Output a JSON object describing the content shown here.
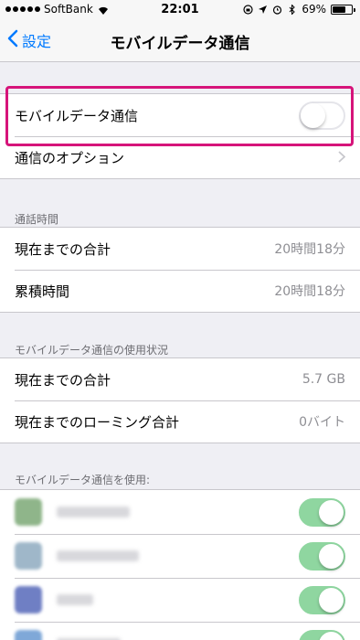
{
  "status_bar": {
    "carrier": "SoftBank",
    "time": "22:01",
    "battery": "69%",
    "battery_level": 0.69
  },
  "nav": {
    "back_label": "設定",
    "title": "モバイルデータ通信"
  },
  "mobile_data": {
    "label": "モバイルデータ通信",
    "enabled": false
  },
  "options": {
    "label": "通信のオプション"
  },
  "call_time": {
    "header": "通話時間",
    "rows": [
      {
        "label": "現在までの合計",
        "value": "20時間18分"
      },
      {
        "label": "累積時間",
        "value": "20時間18分"
      }
    ]
  },
  "usage": {
    "header": "モバイルデータ通信の使用状況",
    "rows": [
      {
        "label": "現在までの合計",
        "value": "5.7 GB"
      },
      {
        "label": "現在までのローミング合計",
        "value": "0バイト"
      }
    ]
  },
  "apps_section": {
    "header": "モバイルデータ通信を使用:",
    "apps": [
      {
        "icon": "blurred-app-icon",
        "color": "#8fb58a",
        "enabled": true
      },
      {
        "icon": "blurred-app-icon",
        "color": "#9fb7c9",
        "enabled": true
      },
      {
        "icon": "blurred-app-icon",
        "color": "#6f7fc4",
        "enabled": true
      },
      {
        "icon": "blurred-app-icon",
        "color": "#7fa8d8",
        "enabled": true
      }
    ]
  },
  "colors": {
    "accent": "#007aff",
    "highlight": "#d6147a",
    "toggle_on": "#8fd6a0",
    "background": "#efeff4"
  }
}
